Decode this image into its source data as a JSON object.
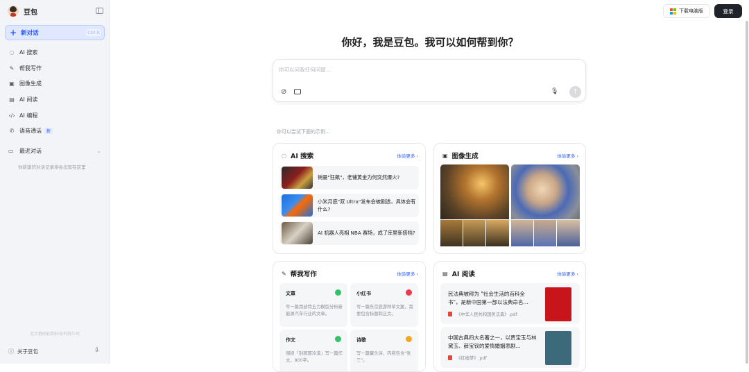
{
  "sidebar": {
    "brand": "豆包",
    "new_chat": "新对话",
    "new_chat_shortcut": "Ctrl K",
    "items": [
      {
        "icon": "ai-search-icon",
        "label": "AI 搜索"
      },
      {
        "icon": "writing-icon",
        "label": "帮我写作"
      },
      {
        "icon": "image-icon",
        "label": "图像生成"
      },
      {
        "icon": "reading-icon",
        "label": "AI 阅读"
      },
      {
        "icon": "code-icon",
        "label": "AI 编程"
      },
      {
        "icon": "phone-icon",
        "label": "语音通话",
        "badge": "新"
      }
    ],
    "recent_label": "最近对话",
    "recent_empty": "你新建的对话记录将会出现在这里",
    "company": "北京春田知韵科技有限公司",
    "about": "关于豆包"
  },
  "topbar": {
    "download": "下载电脑版",
    "login": "登录"
  },
  "greeting": "你好，我是豆包。我可以如何帮到你？",
  "composer": {
    "placeholder": "你可以问我任何问题..."
  },
  "hint": "你可以尝试下面的示例…",
  "cards": {
    "search": {
      "title": "AI 搜索",
      "more": "体验更多 ›",
      "items": [
        "销量\"狂飙\"，老铺黄金为何突然爆火?",
        "小米月底\"双 Ultra\"发布会被剧透，具体会有什么?",
        "AI 机器人亮相 NBA 赛场，成了库里新搭档?"
      ]
    },
    "image": {
      "title": "图像生成",
      "more": "体验更多 ›"
    },
    "writing": {
      "title": "帮我写作",
      "more": "体验更多 ›",
      "tiles": [
        {
          "title": "文章",
          "desc": "写一篇用波特五力模型分析新能源汽车行业的文章。",
          "color": "#34c26b"
        },
        {
          "title": "小红书",
          "desc": "写一篇东京旅游种草文案，需要包含标题和正文。",
          "color": "#f0384f"
        },
        {
          "title": "作文",
          "desc": "围绕「别那那冷漠」写一篇作文，800字。",
          "color": "#34c26b"
        },
        {
          "title": "诗歌",
          "desc": "写一篇藏头诗，内容包含\"张三\"。",
          "color": "#f5a623"
        }
      ]
    },
    "reading": {
      "title": "AI 阅读",
      "more": "体验更多 ›",
      "docs": [
        {
          "text": "民法典被称为 \"社会生活的百科全书\"，是新中国第一部以法典命名...",
          "file": "《中华人民共和国民法典》.pdf"
        },
        {
          "text": "中国古典四大名著之一，以贾宝玉与林黛玉、薛宝钗的爱情婚姻悲剧...",
          "file": "《红楼梦》.pdf"
        }
      ]
    }
  }
}
